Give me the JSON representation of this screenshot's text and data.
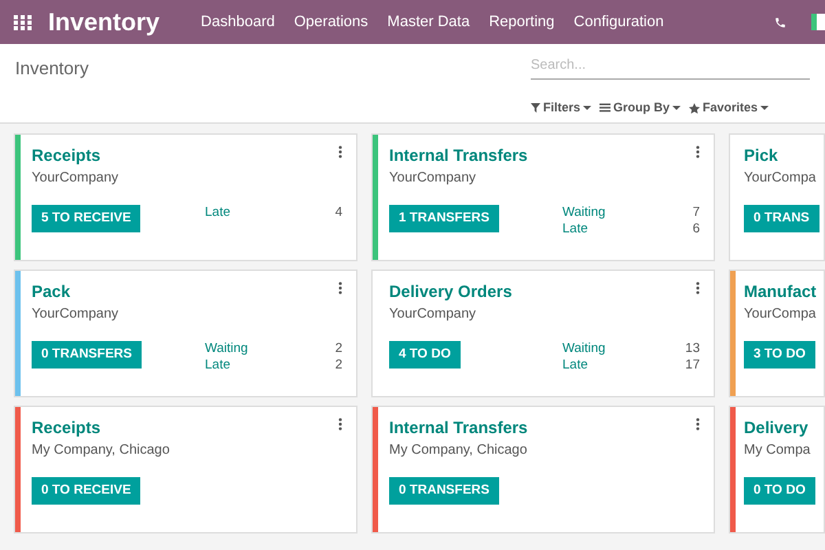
{
  "navbar": {
    "app_title": "Inventory",
    "menu": [
      "Dashboard",
      "Operations",
      "Master Data",
      "Reporting",
      "Configuration"
    ]
  },
  "control_panel": {
    "breadcrumb": "Inventory",
    "search": {
      "placeholder": "Search..."
    },
    "filters": [
      "Filters",
      "Group By",
      "Favorites"
    ]
  },
  "cards": [
    {
      "title": "Receipts",
      "company": "YourCompany",
      "button": "5 TO RECEIVE",
      "color": "#3cc47c",
      "stats": [
        {
          "label": "Late",
          "value": "4"
        }
      ]
    },
    {
      "title": "Internal Transfers",
      "company": "YourCompany",
      "button": "1 TRANSFERS",
      "color": "#3cc47c",
      "stats": [
        {
          "label": "Waiting",
          "value": "7"
        },
        {
          "label": "Late",
          "value": "6"
        }
      ]
    },
    {
      "title": "Pick",
      "company": "YourCompa",
      "button": "0 TRANS"
    },
    {
      "title": "Pack",
      "company": "YourCompany",
      "button": "0 TRANSFERS",
      "color": "#6cc1ed",
      "stats": [
        {
          "label": "Waiting",
          "value": "2"
        },
        {
          "label": "Late",
          "value": "2"
        }
      ]
    },
    {
      "title": "Delivery Orders",
      "company": "YourCompany",
      "button": "4 TO DO",
      "stats": [
        {
          "label": "Waiting",
          "value": "13"
        },
        {
          "label": "Late",
          "value": "17"
        }
      ]
    },
    {
      "title": "Manufact",
      "company": "YourCompa",
      "button": "3 TO DO",
      "color": "#f0a052"
    },
    {
      "title": "Receipts",
      "company": "My Company, Chicago",
      "button": "0 TO RECEIVE",
      "color": "#f05a4a"
    },
    {
      "title": "Internal Transfers",
      "company": "My Company, Chicago",
      "button": "0 TRANSFERS",
      "color": "#f05a4a"
    },
    {
      "title": "Delivery",
      "company": "My Compa",
      "button": "0 TO DO",
      "color": "#f05a4a"
    }
  ]
}
